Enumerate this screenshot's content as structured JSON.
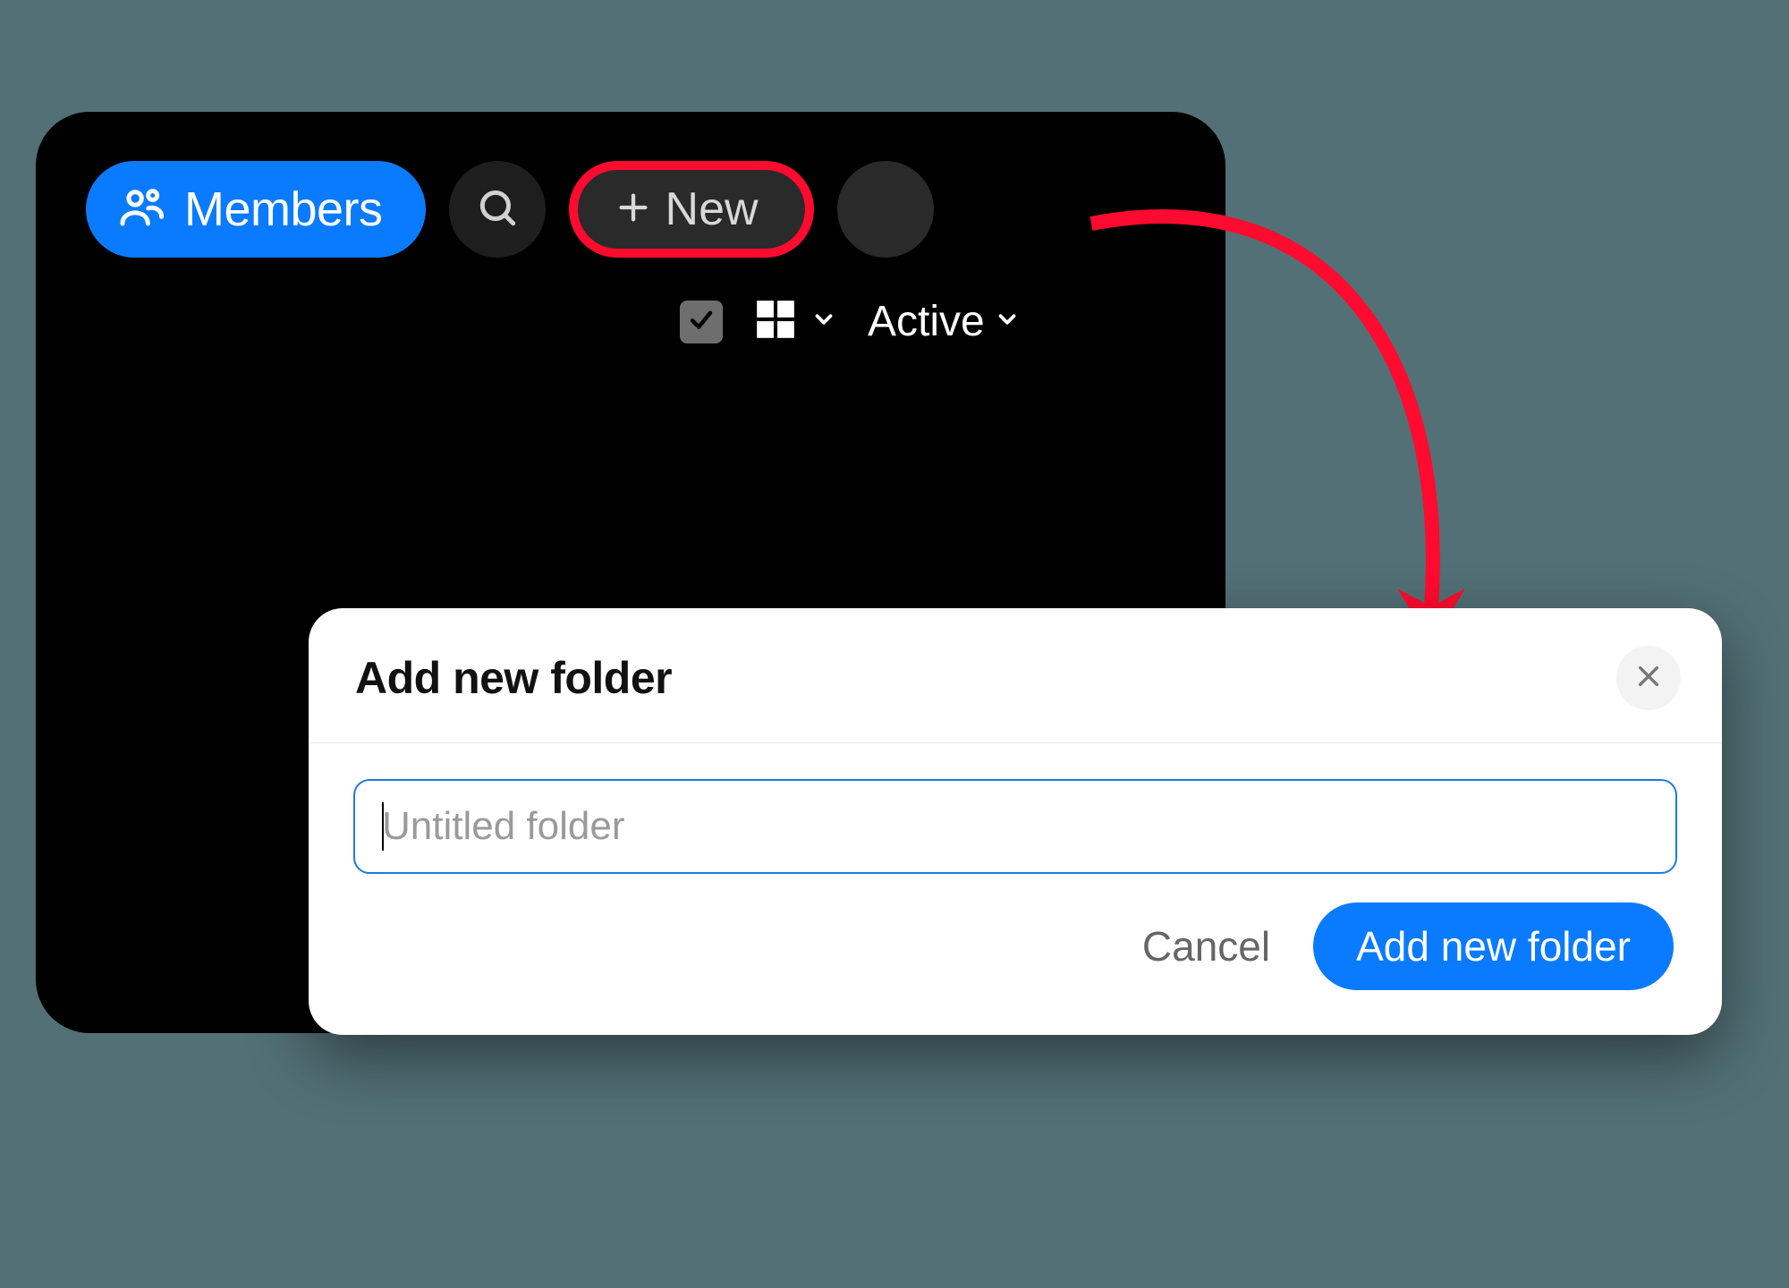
{
  "toolbar": {
    "members_label": "Members",
    "new_label": "New"
  },
  "subbar": {
    "filter_label": "Active"
  },
  "modal": {
    "title": "Add new folder",
    "input_value": "",
    "input_placeholder": "Untitled folder",
    "cancel_label": "Cancel",
    "submit_label": "Add new folder"
  },
  "colors": {
    "accent": "#0a7bff",
    "highlight": "#ff0b2f",
    "panel_bg": "#000000",
    "page_bg": "#527076"
  }
}
